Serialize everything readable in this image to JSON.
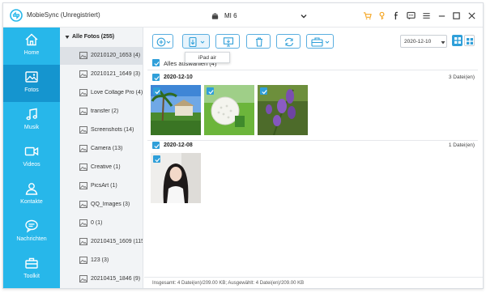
{
  "app": {
    "title": "MobieSync (Unregistriert)",
    "device_name": "MI 6"
  },
  "colors": {
    "accent": "#27b7ea",
    "nav_active": "#1595cf",
    "button_border": "#5aaee0",
    "title_icon_orange": "#f5a623"
  },
  "titlebar_icons": [
    "cart-icon",
    "key-icon",
    "facebook-icon",
    "chat-icon",
    "menu-icon",
    "minimize-icon",
    "maximize-icon",
    "close-icon"
  ],
  "nav": [
    {
      "label": "Home",
      "icon": "home-icon"
    },
    {
      "label": "Fotos",
      "icon": "photo-icon",
      "active": true
    },
    {
      "label": "Musik",
      "icon": "music-icon"
    },
    {
      "label": "Videos",
      "icon": "video-icon"
    },
    {
      "label": "Kontakte",
      "icon": "contacts-icon"
    },
    {
      "label": "Nachrichten",
      "icon": "messages-icon"
    },
    {
      "label": "Toolkit",
      "icon": "toolkit-icon"
    }
  ],
  "albums": {
    "header": "Alle Fotos (255)",
    "items": [
      {
        "label": "20210120_1653 (4)",
        "selected": true
      },
      {
        "label": "20210121_1649 (3)"
      },
      {
        "label": "Love Collage Pro (4)"
      },
      {
        "label": "transfer (2)"
      },
      {
        "label": "Screenshots (14)"
      },
      {
        "label": "Camera (13)"
      },
      {
        "label": "Creative (1)"
      },
      {
        "label": "PicsArt (1)"
      },
      {
        "label": "QQ_Images (3)"
      },
      {
        "label": "0 (1)"
      },
      {
        "label": "20210415_1609 (115)"
      },
      {
        "label": "123 (3)"
      },
      {
        "label": "20210415_1846 (9)"
      }
    ]
  },
  "toolbar": {
    "tooltip": "iPad air",
    "date_value": "2020-12-10"
  },
  "content": {
    "select_all": "Alles auswählen (4)",
    "groups": [
      {
        "date": "2020-12-10",
        "count": "3 Datei(en)"
      },
      {
        "date": "2020-12-08",
        "count": "1 Datei(en)"
      }
    ]
  },
  "status": {
    "text": "Insgesamt: 4 Datei(en)/209.00 KB; Ausgewählt: 4 Datei(en)/209.00 KB"
  }
}
